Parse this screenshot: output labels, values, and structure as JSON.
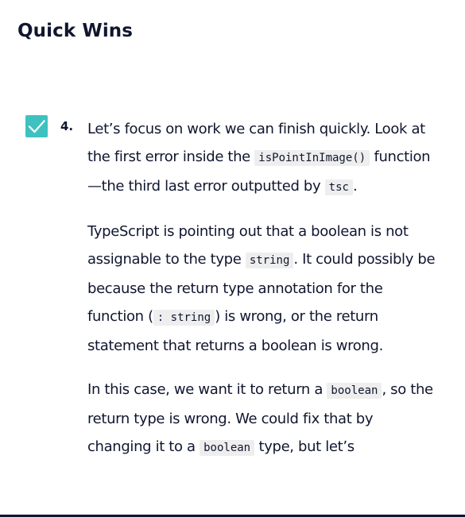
{
  "section": {
    "title": "Quick Wins"
  },
  "task": {
    "number": "4.",
    "checked": true,
    "check_color": "#3dc2c0",
    "paragraphs": [
      {
        "t1": "Let’s focus on work we can finish quickly. Look at the first error inside the ",
        "c1": "isPointInImage()",
        "t2": " function—the third last error outputted by ",
        "c2": "tsc",
        "t3": "."
      },
      {
        "t1": "TypeScript is pointing out that a boolean is not assignable to the type ",
        "c1": "string",
        "t2": ". It could possibly be because the return type annotation for the function (",
        "c2": ": string",
        "t3": ") is wrong, or the return statement that returns a boolean is wrong."
      },
      {
        "t1": "In this case, we want it to return a ",
        "c1": "boolean",
        "t2": ", so the return type is wrong. We could fix that by changing it to a ",
        "c2": "boolean",
        "t3": " type, but let’s"
      }
    ]
  }
}
